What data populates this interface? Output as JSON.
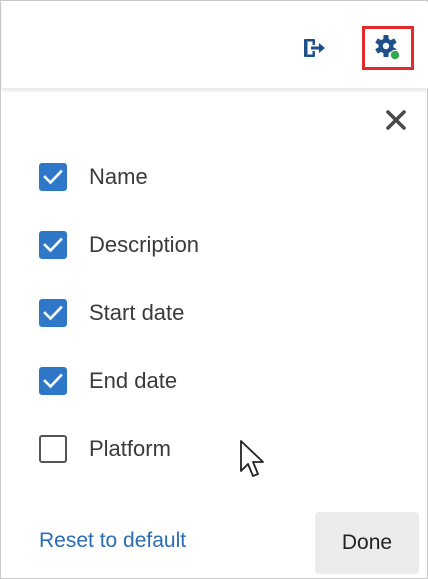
{
  "toolbar": {
    "export_icon": "export-icon",
    "settings_icon": "gear-with-status-dot-icon",
    "settings_highlight_color": "#e02b2b",
    "status_dot_color": "#2fa84f",
    "icon_color": "#1f4f8a"
  },
  "panel": {
    "close_icon": "close-icon",
    "options": [
      {
        "label": "Name",
        "checked": true
      },
      {
        "label": "Description",
        "checked": true
      },
      {
        "label": "Start date",
        "checked": true
      },
      {
        "label": "End date",
        "checked": true
      },
      {
        "label": "Platform",
        "checked": false
      }
    ],
    "checkbox_color": "#2e77c9"
  },
  "footer": {
    "reset_label": "Reset to default",
    "done_label": "Done"
  }
}
